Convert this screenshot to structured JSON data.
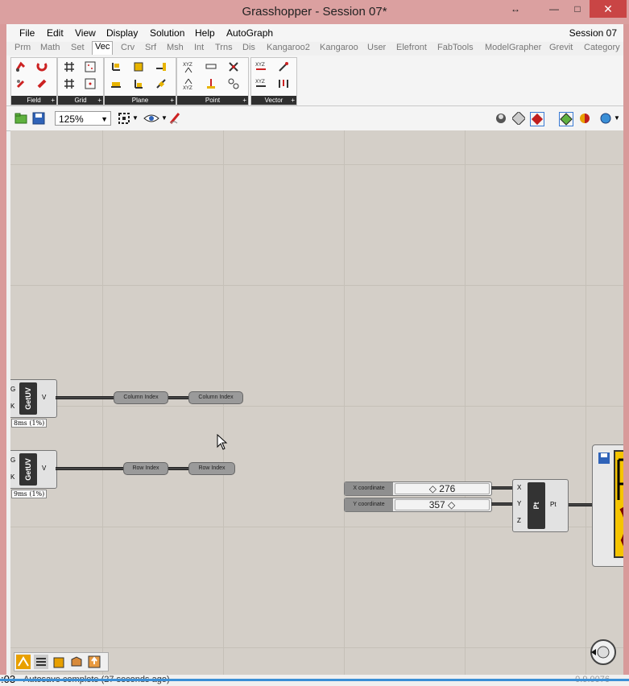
{
  "window": {
    "title": "Grasshopper - Session 07*"
  },
  "menubar": {
    "items": [
      "File",
      "Edit",
      "View",
      "Display",
      "Solution",
      "Help",
      "AutoGraph"
    ],
    "session": "Session 07"
  },
  "tabs": [
    "Prm",
    "Math",
    "Set",
    "Vec",
    "Crv",
    "Srf",
    "Msh",
    "Int",
    "Trns",
    "Dis",
    "Kangaroo2",
    "Kangaroo",
    "User",
    "Elefront",
    "FabTools",
    "ModelGrapher",
    "Grevit",
    "Category"
  ],
  "active_tab": "Vec",
  "ribbon": {
    "groups": [
      {
        "label": "Field",
        "plus": "+"
      },
      {
        "label": "Grid",
        "plus": "+"
      },
      {
        "label": "Plane",
        "plus": "+"
      },
      {
        "label": "Point",
        "plus": "+"
      },
      {
        "label": "Vector",
        "plus": "+"
      }
    ]
  },
  "toolbar": {
    "zoom": "125%"
  },
  "canvas": {
    "getuv1": {
      "name": "GetUV",
      "in1": "G",
      "in2": "K",
      "out": "V",
      "timing": "8ms (1%)"
    },
    "getuv2": {
      "name": "GetUV",
      "in1": "G",
      "in2": "K",
      "out": "V",
      "timing": "9ms (1%)"
    },
    "relay_col_1": "Column Index",
    "relay_col_2": "Column Index",
    "relay_row_1": "Row Index",
    "relay_row_2": "Row Index",
    "slider_x": {
      "name": "X coordinate",
      "value": "◇ 276"
    },
    "slider_y": {
      "name": "Y coordinate",
      "value": "357 ◇"
    },
    "pt": {
      "name": "Pt",
      "in_x": "X",
      "in_y": "Y",
      "in_z": "Z",
      "out": "Pt"
    }
  },
  "status": {
    "left": ":03",
    "message": "Autosave complete (27 seconds ago)",
    "version": "0.9.0076"
  },
  "colors": {
    "title_bg": "#dba0a0",
    "canvas_bg": "#d4cfc8",
    "close_button": "#c94545",
    "progress": "#3a8fd6"
  }
}
